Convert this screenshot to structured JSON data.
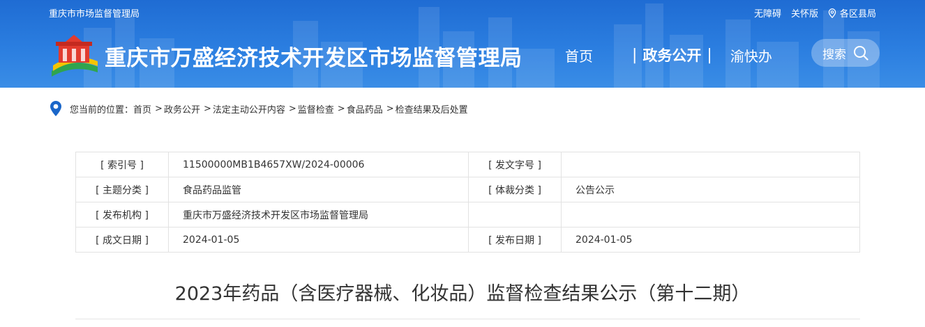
{
  "header": {
    "org_name_small": "重庆市市场监督管理局",
    "links": {
      "accessibility": "无障碍",
      "elderly_mode": "关怀版",
      "regions": "各区县局"
    },
    "site_title": "重庆市万盛经济技术开发区市场监督管理局",
    "nav": [
      {
        "label": "首页",
        "active": false
      },
      {
        "label": "政务公开",
        "active": true
      },
      {
        "label": "渝快办",
        "active": false
      }
    ],
    "search_label": "搜索",
    "colors": {
      "header_blue": "#2b7ee0",
      "logo_red": "#e23b2e",
      "logo_yellow": "#f5c400",
      "logo_green": "#2fa44f"
    }
  },
  "breadcrumb": {
    "prefix": "您当前的位置：",
    "items": [
      "首页",
      "政务公开",
      "法定主动公开内容",
      "监督检查",
      "食品药品",
      "检查结果及后处置"
    ]
  },
  "meta_table": {
    "rows": [
      {
        "k1": "[ 索引号 ]",
        "v1": "11500000MB1B4657XW/2024-00006",
        "k2": "[ 发文字号 ]",
        "v2": ""
      },
      {
        "k1": "[ 主题分类 ]",
        "v1": "食品药品监管",
        "k2": "[ 体裁分类 ]",
        "v2": "公告公示"
      },
      {
        "k1": "[ 发布机构 ]",
        "v1": "重庆市万盛经济技术开发区市场监督管理局",
        "k2": "",
        "v2": ""
      },
      {
        "k1": "[ 成文日期 ]",
        "v1": "2024-01-05",
        "k2": "[ 发布日期 ]",
        "v2": "2024-01-05"
      }
    ]
  },
  "article": {
    "title": "2023年药品（含医疗器械、化妆品）监督检查结果公示（第十二期）"
  }
}
